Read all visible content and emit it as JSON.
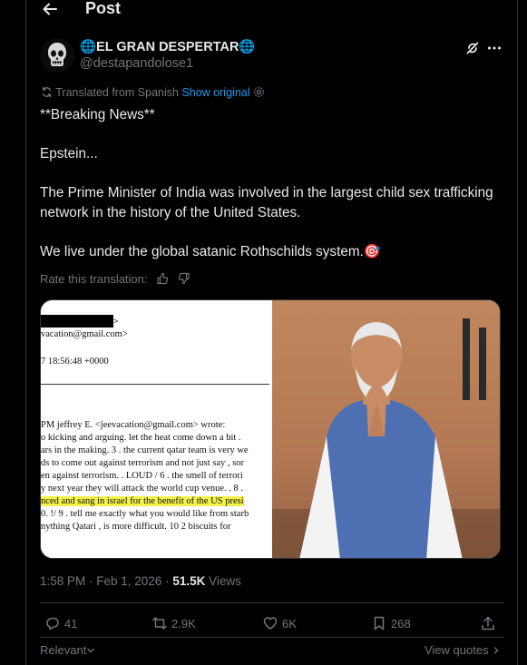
{
  "header": {
    "title": "Post"
  },
  "author": {
    "name": "🌐EL GRAN DESPERTAR🌐",
    "handle": "@destapandolose1"
  },
  "translation": {
    "note": "Translated from Spanish",
    "show_original": "Show original"
  },
  "post": {
    "lines": [
      "**Breaking News**",
      "Epstein...",
      "The Prime Minister of India was involved in the largest child sex trafficking network in the history of the United States.",
      "We live under the global satanic Rothschilds system.🎯"
    ]
  },
  "rate": {
    "label": "Rate this translation:"
  },
  "document": {
    "lines": [
      "vacation@gmail.com>",
      "7 18:56:48 +0000",
      "PM jeffrey E. <jeevacation@gmail.com> wrote:",
      "o kicking and arguing.   let the heat  come down a bit  .",
      "ars in the making.  3 .  the current qatar team is very we",
      "ds to come out against terrorism  and not just say  ,  sor",
      "en against terrorism.  .   LOUD / 6 . the smell of terrori",
      "y next year they will attack the world cup venue.  . 8 .",
      "nced and sang  in israel   for the benefit of the US  presi",
      "0.  !/   9 . tell me exactly what you would like from starb",
      "nything  Qatari  ,  is more difficult.  10    2 biscuits for"
    ]
  },
  "meta": {
    "time": "1:58 PM · Feb 1, 2026 · ",
    "views_count": "51.5K",
    "views_label": " Views"
  },
  "actions": {
    "replies": "41",
    "reposts": "2.9K",
    "likes": "6K",
    "bookmarks": "268"
  },
  "footer": {
    "relevant": "Relevant",
    "view_quotes": "View quotes"
  },
  "colors": {
    "accent": "#1d9bf0",
    "muted": "#71767b",
    "text": "#e7e9ea",
    "border": "#2f3336",
    "highlight": "#f4f24a"
  }
}
